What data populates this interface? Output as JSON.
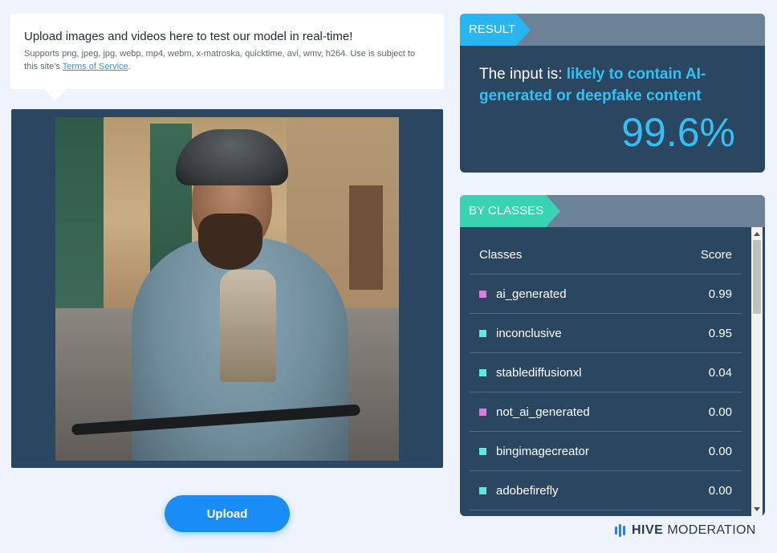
{
  "upload_info": {
    "title": "Upload images and videos here to test our model in real-time!",
    "subtitle_prefix": "Supports png, jpeg, jpg, webp, mp4, webm, x-matroska, quicktime, avi, wmv, h264. Use is subject to this site's ",
    "terms_link": "Terms of Service",
    "subtitle_suffix": "."
  },
  "upload_button": {
    "label": "Upload"
  },
  "result": {
    "tag": "RESULT",
    "prefix": "The input is: ",
    "verdict": "likely to contain AI-generated or deepfake content",
    "score": "99.6%"
  },
  "by_classes": {
    "tag": "BY CLASSES",
    "header": {
      "class_col": "Classes",
      "score_col": "Score"
    },
    "rows": [
      {
        "name": "ai_generated",
        "score": "0.99",
        "color": "#e07ae0"
      },
      {
        "name": "inconclusive",
        "score": "0.95",
        "color": "#5ee8e0"
      },
      {
        "name": "stablediffusionxl",
        "score": "0.04",
        "color": "#5ee8e0"
      },
      {
        "name": "not_ai_generated",
        "score": "0.00",
        "color": "#e07ae0"
      },
      {
        "name": "bingimagecreator",
        "score": "0.00",
        "color": "#5ee8e0"
      },
      {
        "name": "adobefirefly",
        "score": "0.00",
        "color": "#5ee8e0"
      }
    ]
  },
  "brand": {
    "name": "HIVE",
    "sub": "MODERATION",
    "logo_icon": "hive-bars-icon"
  },
  "colors": {
    "accent_blue": "#29b5f0",
    "accent_teal": "#37d3b3",
    "panel": "#2a4660",
    "button": "#1a8cf5"
  }
}
